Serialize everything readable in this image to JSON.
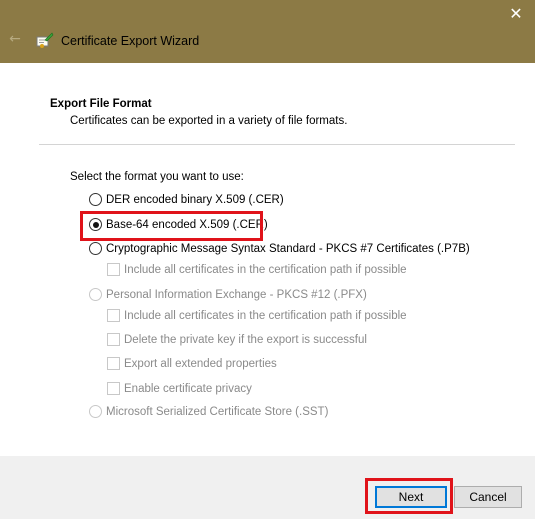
{
  "window": {
    "title": "Certificate Export Wizard",
    "close_glyph": "✕",
    "back_glyph": "←"
  },
  "section": {
    "title": "Export File Format",
    "description": "Certificates can be exported in a variety of file formats."
  },
  "prompt": "Select the format you want to use:",
  "options": [
    {
      "label": "DER encoded binary X.509 (.CER)",
      "checked": false,
      "enabled": true
    },
    {
      "label": "Base-64 encoded X.509 (.CER)",
      "checked": true,
      "enabled": true
    },
    {
      "label": "Cryptographic Message Syntax Standard - PKCS #7 Certificates (.P7B)",
      "checked": false,
      "enabled": true
    },
    {
      "label": "Personal Information Exchange - PKCS #12 (.PFX)",
      "checked": false,
      "enabled": false
    },
    {
      "label": "Microsoft Serialized Certificate Store (.SST)",
      "checked": false,
      "enabled": false
    }
  ],
  "pkcs7_checkboxes": [
    {
      "label": "Include all certificates in the certification path if possible",
      "checked": false,
      "enabled": false
    }
  ],
  "pfx_checkboxes": [
    {
      "label": "Include all certificates in the certification path if possible",
      "checked": false,
      "enabled": false
    },
    {
      "label": "Delete the private key if the export is successful",
      "checked": false,
      "enabled": false
    },
    {
      "label": "Export all extended properties",
      "checked": false,
      "enabled": false
    },
    {
      "label": "Enable certificate privacy",
      "checked": false,
      "enabled": false
    }
  ],
  "buttons": {
    "next": "Next",
    "cancel": "Cancel"
  },
  "colors": {
    "titlebar": "#8c7a45",
    "highlight": "#e0131a",
    "default_button_border": "#0078d7"
  }
}
